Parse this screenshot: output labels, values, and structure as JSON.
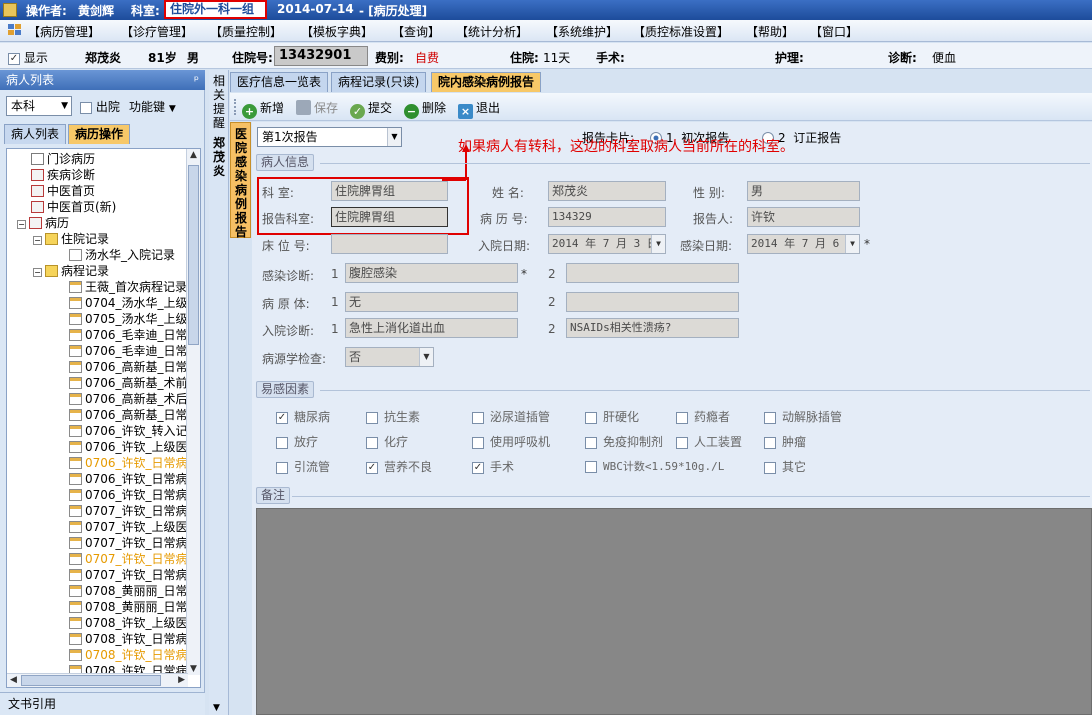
{
  "titlebar": {
    "operator_label": "操作者:",
    "operator_name": "黄剑辉",
    "dept_label": "科室:",
    "dept_name": "住院外一科一组",
    "date": "2014-07-14",
    "window": "- [病历处理]"
  },
  "menu": [
    "【病历管理】",
    "【诊疗管理】",
    "【质量控制】",
    "【模板字典】",
    "【查询】",
    "【统计分析】",
    "【系统维护】",
    "【质控标准设置】",
    "【帮助】",
    "【窗口】"
  ],
  "patient": {
    "show_label": "显示",
    "name": "郑茂炎",
    "age": "81岁",
    "sex": "男",
    "inhosp_no_label": "住院号:",
    "inhosp_no": "13432901",
    "fee_label": "费别:",
    "fee": "自费",
    "stay_label": "住院:",
    "stay": "11天",
    "surgery_label": "手术:",
    "nursing_label": "护理:",
    "diagnosis_label": "诊断:",
    "diagnosis": "便血"
  },
  "left": {
    "panel_title": "病人列表",
    "pin": "ᵖ",
    "dept_select": "本科",
    "discharged_label": "出院",
    "func_label": "功能键",
    "tabs": [
      "病人列表",
      "病历操作"
    ],
    "tree": {
      "outpatient": "门诊病历",
      "disease_diag": "疾病诊断",
      "tcm_front": "中医首页",
      "tcm_front_new": "中医首页(新)",
      "records": "病历",
      "admission": "住院记录",
      "admission_item": "汤水华_入院记录",
      "course": "病程记录",
      "course_items": [
        "王薇_首次病程记录",
        "0704_汤水华_上级",
        "0705_汤水华_上级",
        "0706_毛幸迪_日常",
        "0706_毛幸迪_日常",
        "0706_高新基_日常",
        "0706_高新基_术前",
        "0706_高新基_术后",
        "0706_高新基_日常",
        "0706_许钦_转入记",
        "0706_许钦_上级医",
        "0706_许钦_日常病",
        "0706_许钦_日常病",
        "0706_许钦_日常病",
        "0707_许钦_日常病",
        "0707_许钦_上级医",
        "0707_许钦_日常病",
        "0707_许钦_日常病",
        "0707_许钦_日常病",
        "0708_黄丽丽_日常",
        "0708_黄丽丽_日常",
        "0708_许钦_上级医",
        "0708_许钦_日常病",
        "0708_许钦_日常病",
        "0708_许钦_日常病"
      ]
    },
    "bottom_label": "文书引用"
  },
  "side": {
    "tab1": "相关提醒",
    "tab2": "郑茂炎",
    "tab3": "医院感染病例报告"
  },
  "tabs": [
    "医疗信息一览表",
    "病程记录(只读)",
    "院内感染病例报告"
  ],
  "toolbar": {
    "new": "新增",
    "save": "保存",
    "submit": "提交",
    "delete": "删除",
    "exit": "退出"
  },
  "form": {
    "report_select": "第1次报告",
    "report_card_label": "报告卡片:",
    "radio1": "1",
    "radio1_label": "初次报告",
    "radio2": "2",
    "radio2_label": "订正报告",
    "annotation": "如果病人有转科，这边的科室取病人当前所在的科室。",
    "patient_info_title": "病人信息",
    "dept_label": "科    室:",
    "dept_value": "住院脾胃组",
    "report_dept_label": "报告科室:",
    "report_dept_value": "住院脾胃组",
    "bed_label": "床 位 号:",
    "name_label": "姓    名:",
    "name_value": "郑茂炎",
    "record_no_label": "病 历 号:",
    "record_no_value": "134329",
    "admit_date_label": "入院日期:",
    "admit_date_value": "2014 年 7 月 3 日",
    "sex_label": "性    别:",
    "sex_value": "男",
    "reporter_label": "报告人:",
    "reporter_value": "许钦",
    "infect_date_label": "感染日期:",
    "infect_date_value": "2014 年 7 月 6 日",
    "star": "*",
    "infect_diag_label": "感染诊断:",
    "infect_diag_1": "腹腔感染",
    "infect_diag_2": "",
    "pathogen_label": "病 原 体:",
    "pathogen_1": "无",
    "pathogen_2": "",
    "admit_diag_label": "入院诊断:",
    "admit_diag_1": "急性上消化道出血",
    "admit_diag_2": "NSAIDs相关性溃疡?",
    "n1": "1",
    "n2": "2",
    "pathogen_check_label": "病源学检查:",
    "pathogen_check_value": "否",
    "risk_title": "易感因素",
    "risks": [
      {
        "label": "糖尿病",
        "checked": true
      },
      {
        "label": "抗生素",
        "checked": false
      },
      {
        "label": "泌尿道插管",
        "checked": false
      },
      {
        "label": "肝硬化",
        "checked": false
      },
      {
        "label": "药瘾者",
        "checked": false
      },
      {
        "label": "动解脉插管",
        "checked": false
      },
      {
        "label": "放疗",
        "checked": false
      },
      {
        "label": "化疗",
        "checked": false
      },
      {
        "label": "使用呼吸机",
        "checked": false
      },
      {
        "label": "免疫抑制剂",
        "checked": false
      },
      {
        "label": "人工装置",
        "checked": false
      },
      {
        "label": "肿瘤",
        "checked": false
      },
      {
        "label": "引流管",
        "checked": false
      },
      {
        "label": "营养不良",
        "checked": true
      },
      {
        "label": "手术",
        "checked": true
      },
      {
        "label": "WBC计数<1.59*10g./L",
        "checked": false
      },
      {
        "label": "其它",
        "checked": false
      }
    ],
    "remark_title": "备注"
  },
  "colors": {
    "annotation_red": "#e00000",
    "fee_red": "#d00000",
    "active_tab": "#f7c868",
    "orange_item": "#e69a00"
  }
}
